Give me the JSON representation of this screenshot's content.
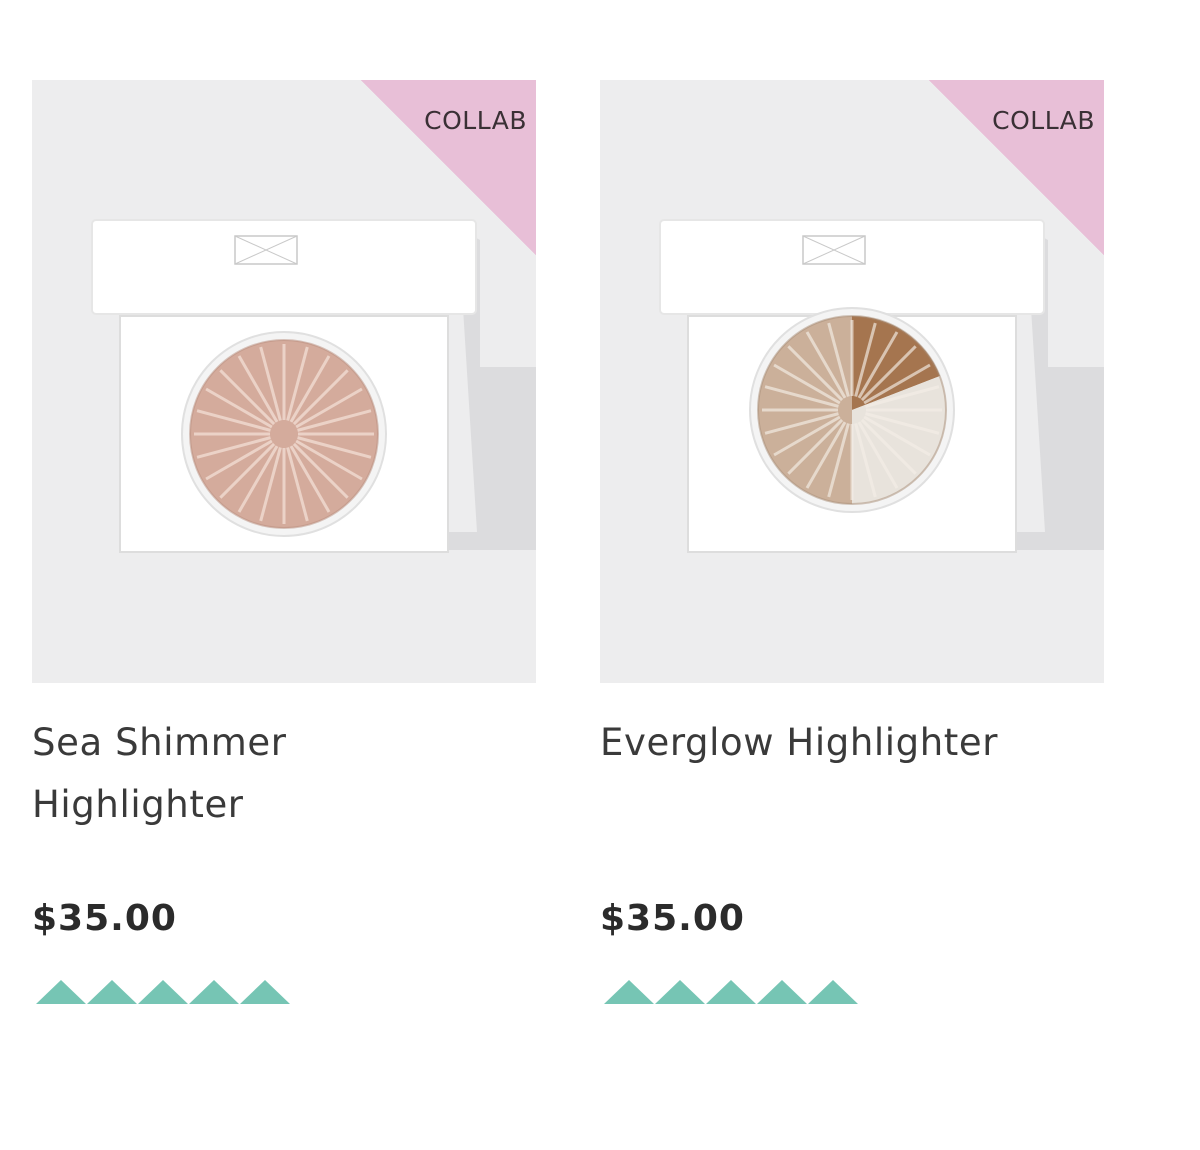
{
  "colors": {
    "badge": "#e8bfd7",
    "rating": "#76c5b4",
    "image_bg": "#ededee",
    "price": "#2b2b2b"
  },
  "products": [
    {
      "badge": "COLLAB",
      "name_line1": "Sea Shimmer",
      "name_line2": "Highlighter",
      "price": "$35.00",
      "rating": 5,
      "rating_max": 5,
      "pan_colors": [
        "#d9b2a4",
        "#c39586"
      ]
    },
    {
      "badge": "COLLAB",
      "name_line1": "Everglow Highlighter",
      "name_line2": "",
      "price": "$35.00",
      "rating": 5,
      "rating_max": 5,
      "pan_colors": [
        "#a5754f",
        "#e8e3dc",
        "#cbb09a"
      ]
    }
  ]
}
